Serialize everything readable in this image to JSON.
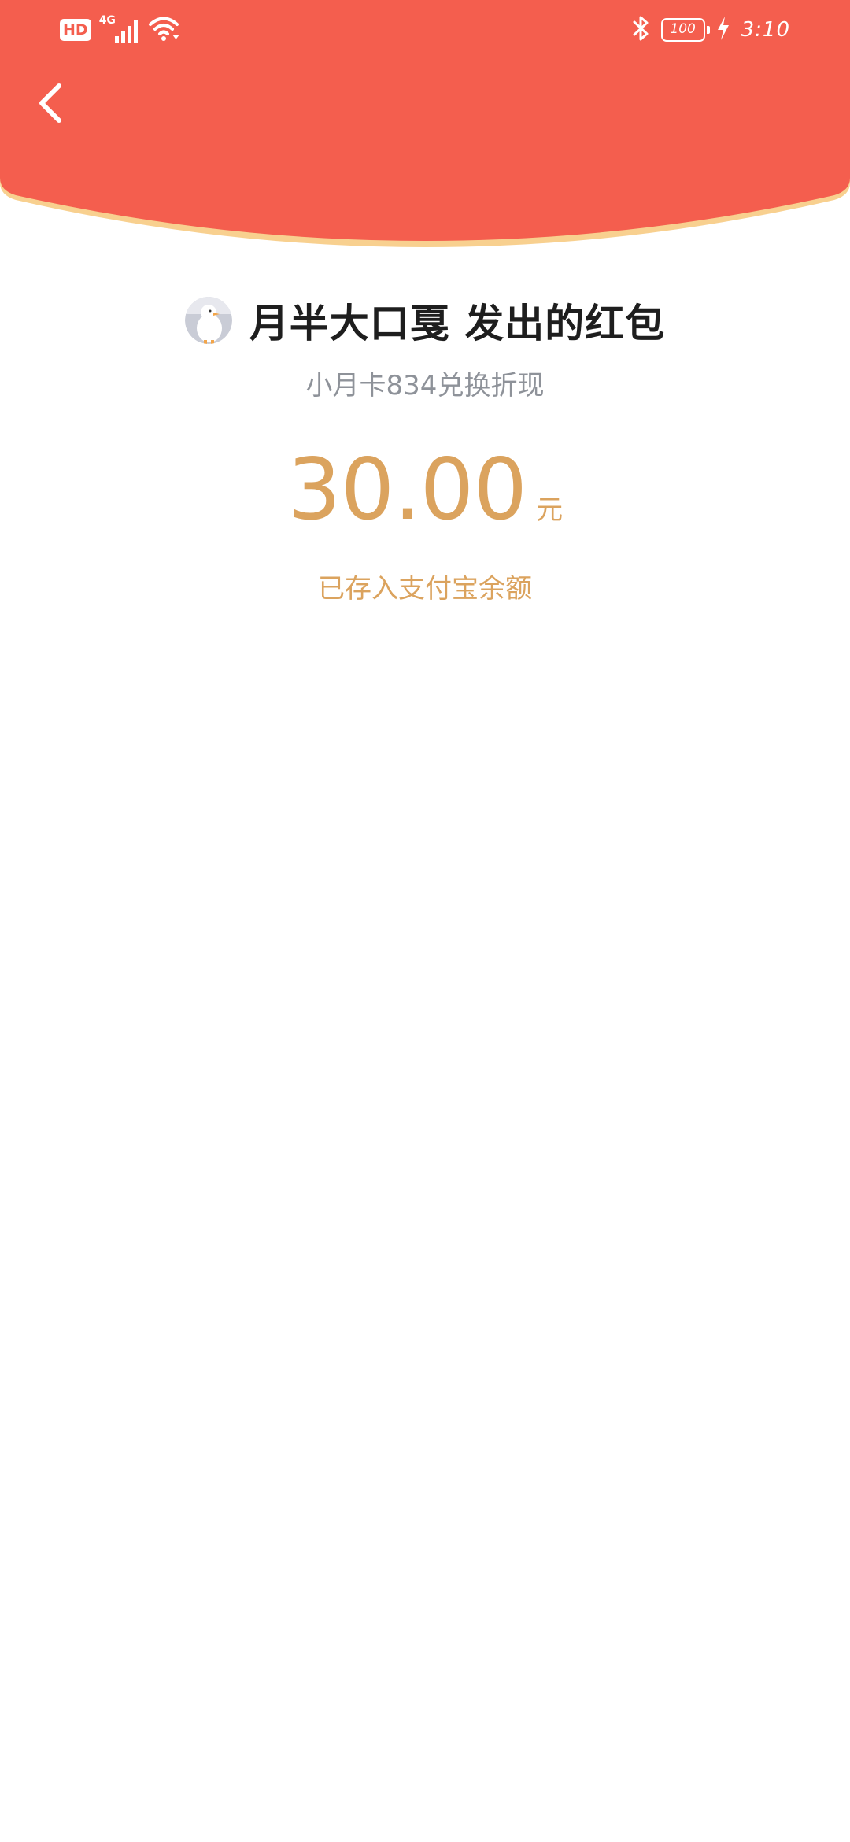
{
  "status_bar": {
    "hd_label": "HD",
    "network_label": "4G",
    "battery_level": "100",
    "time": "3:10",
    "icons": [
      "signal-icon",
      "wifi-icon",
      "bluetooth-icon",
      "battery-icon",
      "charging-icon"
    ]
  },
  "header": {
    "back_icon": "chevron-left-icon",
    "color": "#f45e4e",
    "edge_color": "#f8d08f"
  },
  "red_packet": {
    "sender_title": "月半大口戛 发出的红包",
    "subtitle": "小月卡834兑换折现",
    "amount": "30.00",
    "unit": "元",
    "status_note": "已存入支付宝余额"
  },
  "colors": {
    "accent_gold": "#dba35e",
    "subtitle_gray": "#8e9299",
    "title_dark": "#1e1e1e"
  }
}
